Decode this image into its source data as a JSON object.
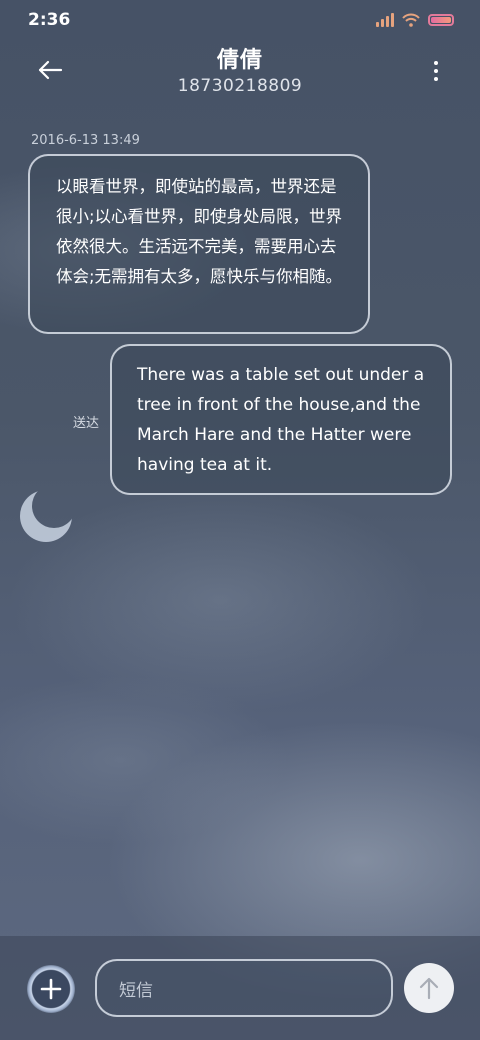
{
  "status_bar": {
    "time": "2:36"
  },
  "header": {
    "contact_name": "倩倩",
    "contact_number": "18730218809"
  },
  "conversation": {
    "timestamp": "2016-6-13 13:49",
    "messages": [
      {
        "direction": "incoming",
        "text": "以眼看世界，即使站的最高，世界还是很小;以心看世界，即使身处局限，世界依然很大。生活远不完美，需要用心去体会;无需拥有太多，愿快乐与你相随。"
      },
      {
        "direction": "outgoing",
        "text": "There was a table set out under a tree in front of the house,and the March Hare and the Hatter were having tea at it.",
        "status": "送达"
      }
    ]
  },
  "composer": {
    "placeholder": "短信"
  },
  "icons": {
    "back": "arrow-left-icon",
    "more": "more-vertical-icon",
    "add": "plus-icon",
    "send": "arrow-up-icon",
    "decoration": "crescent-moon-icon"
  },
  "colors": {
    "background": "#4a5668",
    "bubble_border": "#dce2eb",
    "send_button": "#eef0f3"
  }
}
